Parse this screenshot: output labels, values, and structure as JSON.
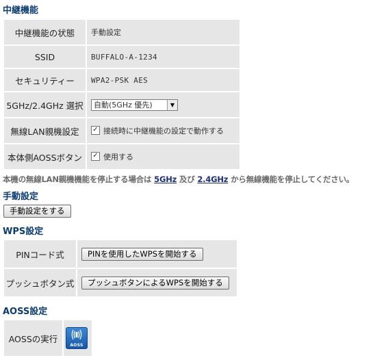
{
  "repeater": {
    "title": "中継機能",
    "rows": [
      {
        "label": "中継機能の状態",
        "value": "手動設定"
      },
      {
        "label": "SSID",
        "value": "BUFFALO-A-1234"
      },
      {
        "label": "セキュリティー",
        "value": "WPA2-PSK AES"
      },
      {
        "label": "5GHz/2.4GHz 選択",
        "select_value": "自動(5GHz 優先)"
      },
      {
        "label": "無線LAN親機設定",
        "checkbox_checked": true,
        "checkbox_label": "接続時に中継機能の設定で動作する"
      },
      {
        "label": "本体側AOSSボタン",
        "checkbox_checked": true,
        "checkbox_label": "使用する"
      }
    ]
  },
  "notice": {
    "prefix": "本機の無線LAN親機機能を停止する場合は",
    "link_5ghz": "5GHz",
    "middle": "及び",
    "link_24ghz": "2.4GHz",
    "suffix": "から無線機能を停止してください。"
  },
  "manual": {
    "title": "手動設定",
    "button_label": "手動設定をする"
  },
  "wps": {
    "title": "WPS設定",
    "rows": [
      {
        "label": "PINコード式",
        "button_label": "PINを使用したWPSを開始する"
      },
      {
        "label": "プッシュボタン式",
        "button_label": "プッシュボタンによるWPSを開始する"
      }
    ]
  },
  "aoss": {
    "title": "AOSS設定",
    "row_label": "AOSSの実行",
    "icon_text": "AOSS",
    "icon_name": "aoss-wireless-icon"
  },
  "colors": {
    "section_title": "#0b3c72",
    "cell_background": "#e6e6e6",
    "link": "#1b2f7a",
    "aoss_icon_blue": "#1659a8"
  }
}
